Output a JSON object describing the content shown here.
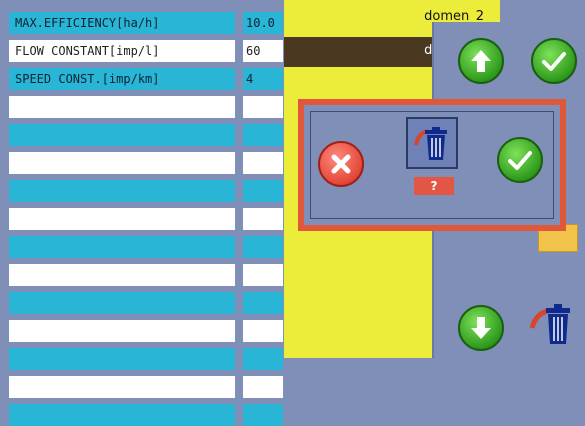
{
  "params": {
    "rows": [
      {
        "label": "MAX.EFFICIENCY[ha/h]",
        "value": "10.0",
        "style": "cyan"
      },
      {
        "label": "FLOW CONSTANT[imp/l]",
        "value": "60",
        "style": "white"
      },
      {
        "label": "SPEED CONST.[imp/km]",
        "value": "4",
        "style": "cyan"
      },
      {
        "label": "",
        "value": "",
        "style": "white"
      },
      {
        "label": "",
        "value": "",
        "style": "cyan"
      },
      {
        "label": "",
        "value": "",
        "style": "white"
      },
      {
        "label": "",
        "value": "",
        "style": "cyan"
      },
      {
        "label": "",
        "value": "",
        "style": "white"
      },
      {
        "label": "",
        "value": "",
        "style": "cyan"
      },
      {
        "label": "",
        "value": "",
        "style": "white"
      },
      {
        "label": "",
        "value": "",
        "style": "cyan"
      },
      {
        "label": "",
        "value": "",
        "style": "white"
      },
      {
        "label": "",
        "value": "",
        "style": "cyan"
      },
      {
        "label": "",
        "value": "",
        "style": "white"
      },
      {
        "label": "",
        "value": "",
        "style": "cyan"
      }
    ]
  },
  "domains": [
    {
      "label": "domen_2"
    },
    {
      "label": "domen_2"
    }
  ],
  "dialog": {
    "question": "?",
    "cancel_icon": "x-icon",
    "confirm_icon": "check-icon",
    "trash_icon": "trash-icon"
  },
  "colors": {
    "background": "#7f8fb8",
    "row_cyan": "#29b6d6",
    "yellow_panel": "#ecec3a",
    "selected_row": "#4b3820",
    "dialog_border": "#e0573a",
    "green_button": "#2f9a1c",
    "red_button": "#e4473a"
  }
}
